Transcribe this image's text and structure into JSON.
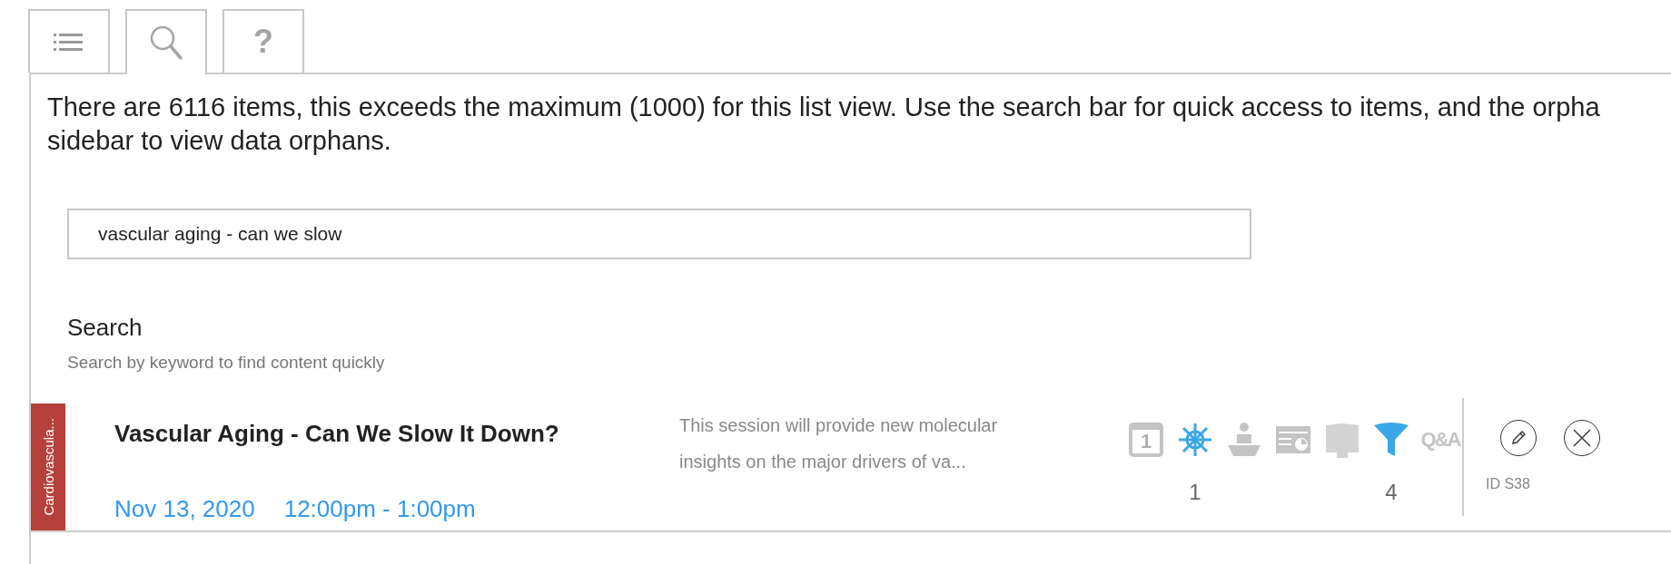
{
  "tabs": [
    {
      "kind": "list",
      "selected": false
    },
    {
      "kind": "search",
      "selected": true
    },
    {
      "kind": "help",
      "label": "?",
      "selected": false
    }
  ],
  "notice": {
    "lines": [
      "There are 6116 items, this exceeds the maximum (1000) for this list view. Use the search bar for quick access to items, and the orpha",
      "sidebar to view data orphans."
    ]
  },
  "search": {
    "value": "vascular aging - can we slow"
  },
  "search_section": {
    "title": "Search",
    "subtitle": "Search by keyword to find content quickly"
  },
  "results": [
    {
      "category": "Cardiovascula...",
      "color": "#b5413a",
      "title": "Vascular Aging - Can We Slow It Down?",
      "date": "Nov 13, 2020",
      "time": "12:00pm - 1:00pm",
      "description": "This session will provide new molecular insights on the major drivers of va...",
      "features": [
        {
          "kind": "calendar",
          "label": "1",
          "active": false
        },
        {
          "kind": "wheel",
          "active": true,
          "count": "1"
        },
        {
          "kind": "speaker",
          "active": false
        },
        {
          "kind": "presentation",
          "active": false
        },
        {
          "kind": "poster",
          "active": false
        },
        {
          "kind": "funnel",
          "active": true,
          "count": "4"
        },
        {
          "kind": "qa",
          "label": "Q&A",
          "active": false
        }
      ],
      "id": "ID S38"
    }
  ]
}
